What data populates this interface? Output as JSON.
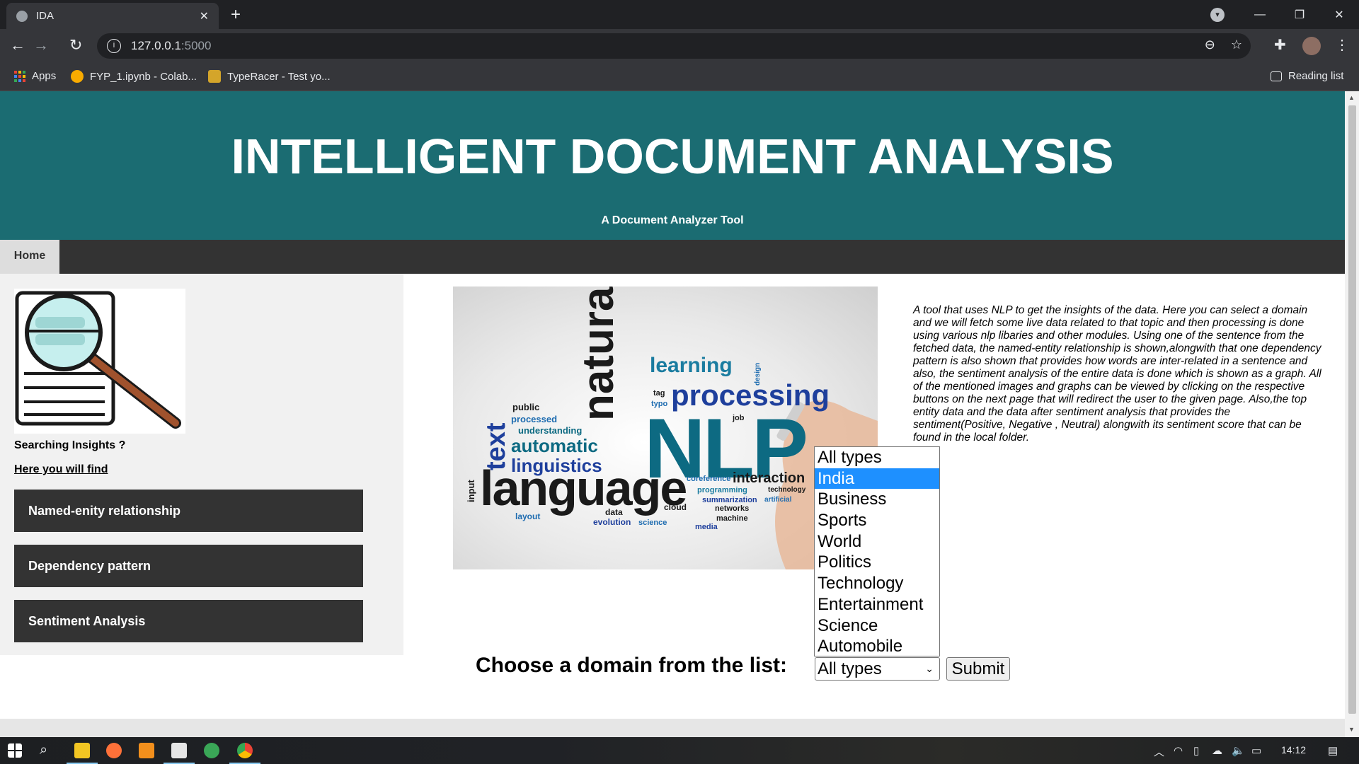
{
  "browser": {
    "tab_title": "IDA",
    "tab_close": "✕",
    "new_tab": "+",
    "url_host": "127.0.0.1",
    "url_port": ":5000",
    "bookmarks": [
      {
        "label": "Apps"
      },
      {
        "label": "FYP_1.ipynb - Colab..."
      },
      {
        "label": "TypeRacer - Test yo..."
      }
    ],
    "reading_list": "Reading list"
  },
  "header": {
    "title": "INTELLIGENT DOCUMENT ANALYSIS",
    "tagline": "A Document Analyzer Tool"
  },
  "nav": {
    "home": "Home"
  },
  "sidebar": {
    "question": "Searching Insights ?",
    "link": "Here you will find",
    "buttons": [
      {
        "label": "Named-enity relationship"
      },
      {
        "label": "Dependency pattern"
      },
      {
        "label": "Sentiment Analysis"
      }
    ]
  },
  "hero_words": {
    "nlp": "NLP",
    "natural": "natural",
    "language": "language",
    "processing": "processing",
    "learning": "learning",
    "text": "text",
    "automatic": "automatic",
    "linguistics": "linguistics",
    "understanding": "understanding",
    "processed": "processed",
    "public": "public",
    "interaction": "interaction",
    "coreference": "coreference",
    "programming": "programming",
    "summarization": "summarization",
    "networks": "networks",
    "machine": "machine",
    "cloud": "cloud",
    "data": "data",
    "evolution": "evolution",
    "science": "science",
    "media": "media",
    "layout": "layout",
    "input": "input",
    "tag": "tag",
    "typo": "typo",
    "job": "job",
    "design": "design",
    "technology": "technology",
    "artificial": "artificial"
  },
  "description": "A tool that uses NLP to get the insights of the data. Here you can select a domain and we will fetch some live data related to that topic and then processing is done using various nlp libaries and other modules. Using one of the sentence from the fetched data, the named-entity relationship is shown,alongwith that one dependency pattern is also shown that provides how words are inter-related in a sentence and also, the sentiment analysis of the entire data is done which is shown as a graph. All of the mentioned images and graphs can be viewed by clicking on the respective buttons on the next page that will redirect the user to the given page. Also,the top entity data and the data after sentiment analysis that provides the sentiment(Positive, Negative , Neutral) alongwith its sentiment score that can be found in the local folder.",
  "form": {
    "label": "Choose a domain from the list:",
    "selected": "All types",
    "submit": "Submit",
    "options": [
      "All types",
      "India",
      "Business",
      "Sports",
      "World",
      "Politics",
      "Technology",
      "Entertainment",
      "Science",
      "Automobile"
    ],
    "highlighted_option": "India"
  },
  "taskbar": {
    "time": "14:12"
  },
  "colors": {
    "header_bg": "#1b6c72",
    "nav_bg": "#333333",
    "sidebar_bg": "#f1f1f1",
    "dropdown_highlight": "#1e90ff"
  }
}
